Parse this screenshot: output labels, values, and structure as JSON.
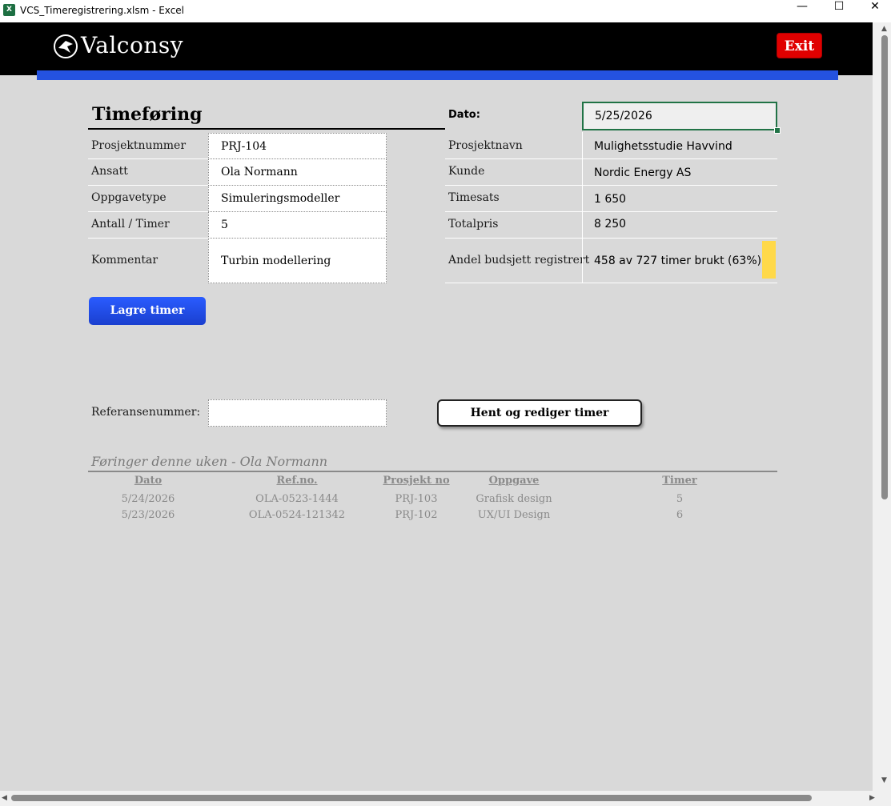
{
  "window": {
    "title": "VCS_Timeregistrering.xlsm - Excel",
    "app_icon": "X",
    "minimize_icon": "—",
    "maximize_icon": "☐",
    "close_icon": "✕"
  },
  "header": {
    "brand": "Valconsy",
    "exit_label": "Exit",
    "colors": {
      "header_bg": "#000000",
      "accent_bar": "#2452e0",
      "exit_bg": "#e00000"
    }
  },
  "form": {
    "title": "Timeføring",
    "date_label": "Dato:",
    "date_value": "5/25/2026",
    "left_fields": [
      {
        "label": "Prosjektnummer",
        "value": "PRJ-104"
      },
      {
        "label": "Ansatt",
        "value": "Ola Normann"
      },
      {
        "label": "Oppgavetype",
        "value": "Simuleringsmodeller"
      },
      {
        "label": "Antall / Timer",
        "value": "5"
      },
      {
        "label": "Kommentar",
        "value": "Turbin modellering"
      }
    ],
    "right_fields": [
      {
        "label": "Prosjektnavn",
        "value": "Mulighetsstudie Havvind"
      },
      {
        "label": "Kunde",
        "value": "Nordic Energy AS"
      },
      {
        "label": "Timesats",
        "value": "1 650"
      },
      {
        "label": "Totalpris",
        "value": "8 250"
      },
      {
        "label": "Andel budsjett registrert",
        "value": "458 av 727 timer brukt (63%)"
      }
    ],
    "budget_indicator_color": "#ffd94a",
    "save_label": "Lagre timer",
    "ref_label": "Referansenummer:",
    "ref_value": "",
    "fetch_label": "Hent og rediger timer"
  },
  "entries": {
    "title": "Føringer denne uken - Ola Normann",
    "columns": [
      "Dato",
      "Ref.no.",
      "Prosjekt no",
      "Oppgave",
      "Timer"
    ],
    "rows": [
      [
        "5/24/2026",
        "OLA-0523-1444",
        "PRJ-103",
        "Grafisk design",
        "5"
      ],
      [
        "5/23/2026",
        "OLA-0524-121342",
        "PRJ-102",
        "UX/UI Design",
        "6"
      ]
    ]
  },
  "scrollbars": {
    "up": "▲",
    "down": "▼",
    "left": "◀",
    "right": "▶"
  }
}
